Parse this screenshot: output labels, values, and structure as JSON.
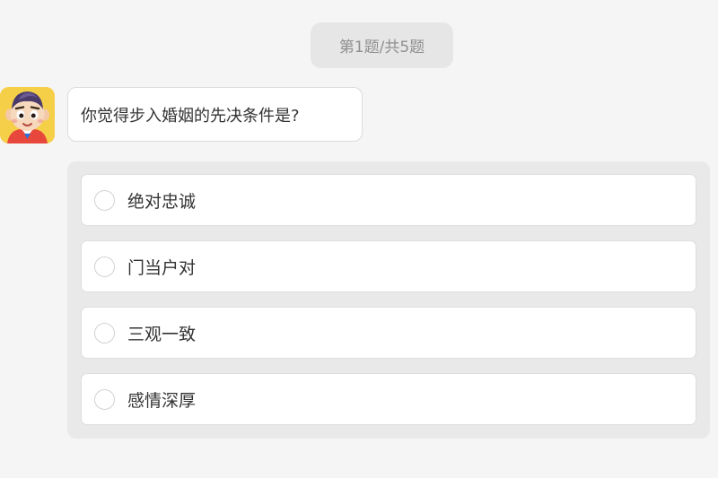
{
  "progress": "第1题/共5题",
  "question": {
    "text": "你觉得步入婚姻的先决条件是?",
    "avatar_icon": "cartoon-boy-avatar"
  },
  "options": [
    {
      "label": "绝对忠诚",
      "selected": false
    },
    {
      "label": "门当户对",
      "selected": false
    },
    {
      "label": "三观一致",
      "selected": false
    },
    {
      "label": "感情深厚",
      "selected": false
    }
  ],
  "colors": {
    "background": "#f5f5f5",
    "pill": "#e6e6e6",
    "panel": "#e9e9e9",
    "avatar_bg": "#f6cf49"
  }
}
